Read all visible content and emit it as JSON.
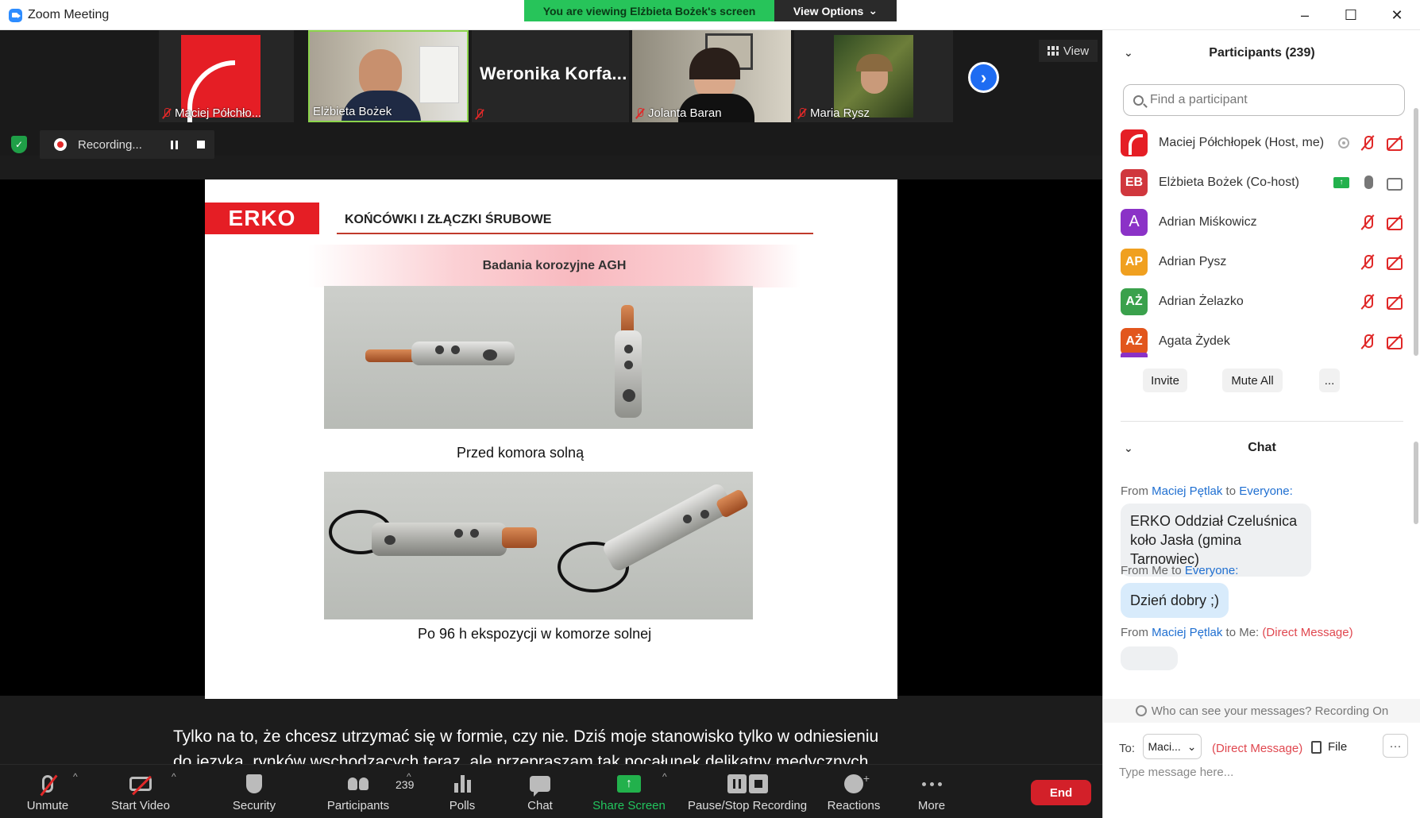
{
  "window": {
    "title": "Zoom Meeting",
    "controls": {
      "minimize": "–",
      "maximize": "☐",
      "close": "✕"
    }
  },
  "banner": {
    "viewing": "You are viewing Elżbieta Bożek's screen",
    "view_options": "View Options",
    "caret": "⌄"
  },
  "thumbnails": [
    {
      "name": "Maciej Półchło...",
      "muted": true
    },
    {
      "name": "Elżbieta Bożek",
      "muted": false
    },
    {
      "name": "",
      "big_name": "Weronika  Korfa...",
      "muted": true
    },
    {
      "name": "Jolanta Baran",
      "muted": true
    },
    {
      "name": "Maria Rysz",
      "muted": true
    }
  ],
  "view_button": "View",
  "next_page": "›",
  "recording": {
    "label": "Recording...",
    "shield": "✓"
  },
  "slide": {
    "logo": "ERKO",
    "heading": "KOŃCÓWKI I ZŁĄCZKI ŚRUBOWE",
    "subtitle": "Badania korozyjne  AGH",
    "caption_before": "Przed komora solną",
    "caption_after": "Po 96 h ekspozycji w komorze solnej"
  },
  "transcript": {
    "line1": "Tylko na to, że chcesz utrzymać się w formie, czy nie. Dziś moje stanowisko tylko w odniesieniu",
    "line2": "do języka, rynków wschodzących teraz, ale przepraszam tak pocałunek delikatny medycznych"
  },
  "toolbar": {
    "unmute": "Unmute",
    "start_video": "Start Video",
    "security": "Security",
    "participants": "Participants",
    "participants_count": "239",
    "polls": "Polls",
    "chat": "Chat",
    "share_screen": "Share Screen",
    "pause_stop": "Pause/Stop Recording",
    "reactions": "Reactions",
    "more": "More",
    "end": "End",
    "caret": "^",
    "share_glyph": "↑",
    "react_glyph": "+"
  },
  "participants_panel": {
    "title": "Participants (239)",
    "collapse": "⌄",
    "search_placeholder": "Find a participant",
    "people": [
      {
        "initials": "",
        "name": "Maciej Półchłopek (Host, me)",
        "color": "#e51e25",
        "logo": true
      },
      {
        "initials": "EB",
        "name": "Elżbieta Bożek (Co-host)",
        "color": "#d0373d",
        "sharing": true
      },
      {
        "initials": "A",
        "name": "Adrian Miśkowicz",
        "color": "#8b32c7"
      },
      {
        "initials": "AP",
        "name": "Adrian Pysz",
        "color": "#f0a020"
      },
      {
        "initials": "AŻ",
        "name": "Adrian Żelazko",
        "color": "#3aa14c"
      },
      {
        "initials": "AŻ",
        "name": "Agata Żydek",
        "color": "#e2561d"
      }
    ],
    "actions": {
      "invite": "Invite",
      "mute_all": "Mute All",
      "more": "..."
    },
    "share_glyph": "↑"
  },
  "chat_panel": {
    "title": "Chat",
    "collapse": "⌄",
    "messages": [
      {
        "from_prefix": "From ",
        "from": "Maciej Pętlak",
        "to_prefix": " to ",
        "to": "Everyone:",
        "dm": "",
        "text_line1": "ERKO Oddział Czeluśnica",
        "text_line2": "koło Jasła (gmina Tarnowiec)"
      },
      {
        "from_prefix": "From Me to ",
        "from": "",
        "to_prefix": "",
        "to": "Everyone:",
        "dm": "",
        "text_line1": "Dzień dobry ;)",
        "text_line2": ""
      },
      {
        "from_prefix": "From ",
        "from": "Maciej Pętlak",
        "to_prefix": " to Me: ",
        "to": "",
        "dm": "(Direct Message)",
        "text_line1": "",
        "text_line2": ""
      }
    ],
    "privacy_note": "Who can see your messages? Recording On",
    "to_label": "To:",
    "to_value": "Maci...",
    "dm_label": "(Direct Message)",
    "file_label": "File",
    "more": "···",
    "input_placeholder": "Type message here..."
  },
  "colors": {
    "accent_blue": "#1e6cf2",
    "share_green": "#22b14c",
    "end_red": "#d32029",
    "erko_red": "#e51e25"
  }
}
